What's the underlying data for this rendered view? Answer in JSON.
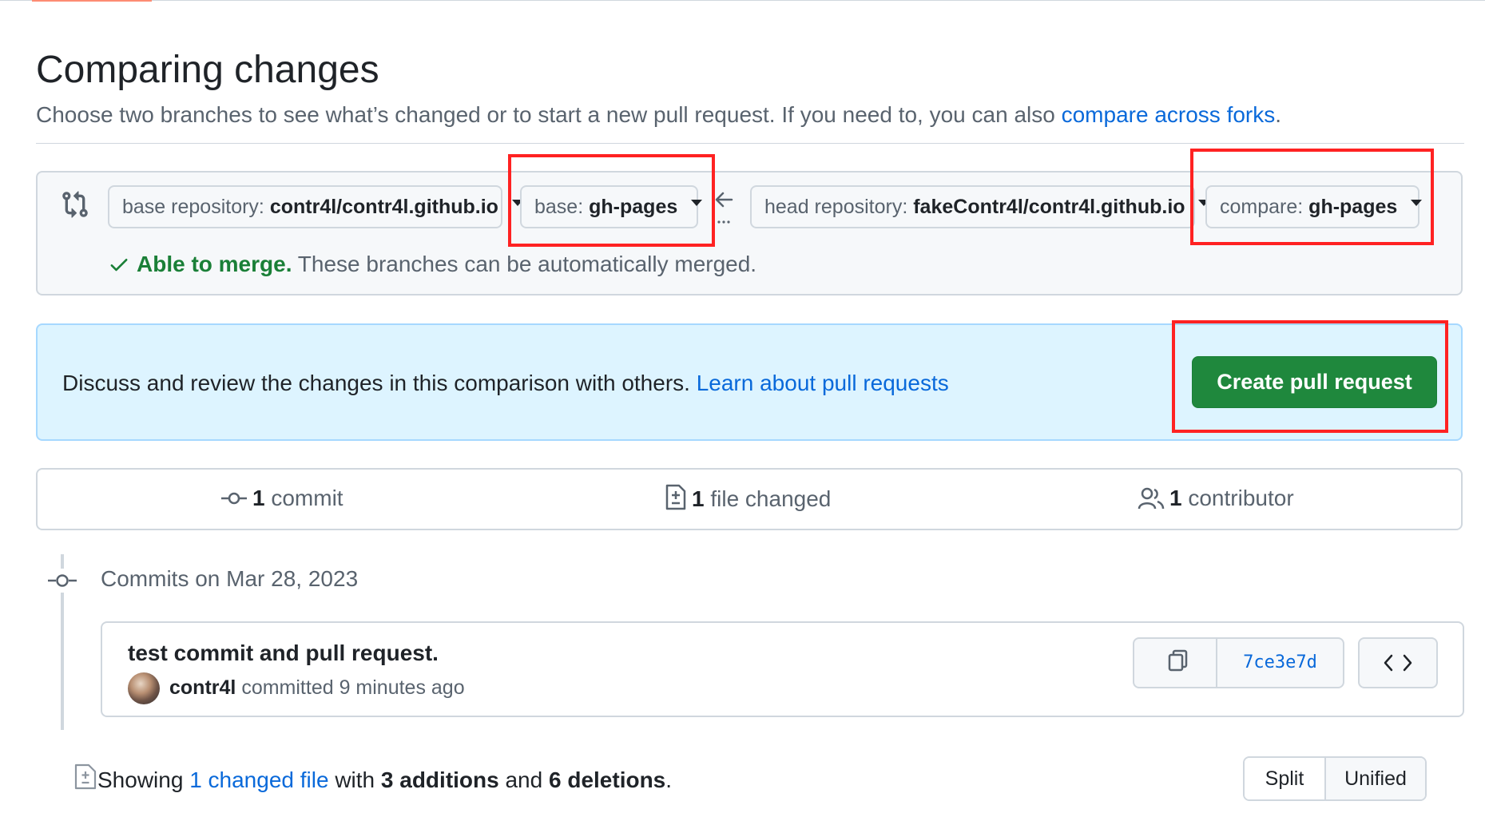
{
  "page": {
    "title": "Comparing changes",
    "subtitle_prefix": "Choose two branches to see what’s changed or to start a new pull request. If you need to, you can also",
    "subtitle_link": "compare across forks",
    "subtitle_suffix": "."
  },
  "range": {
    "base_repo_label": "base repository:",
    "base_repo_value": "contr4l/contr4l.github.io",
    "base_label": "base:",
    "base_value": "gh-pages",
    "head_repo_label": "head repository:",
    "head_repo_value": "fakeContr4l/contr4l.github.io",
    "compare_label": "compare:",
    "compare_value": "gh-pages",
    "merge_status": "Able to merge.",
    "merge_detail": "These branches can be automatically merged."
  },
  "discuss": {
    "text": "Discuss and review the changes in this comparison with others.",
    "link": "Learn about pull requests",
    "button": "Create pull request"
  },
  "summary": {
    "commits_count": "1",
    "commits_label": "commit",
    "files_count": "1",
    "files_label": "file changed",
    "contributors_count": "1",
    "contributors_label": "contributor"
  },
  "commits": {
    "date_heading": "Commits on Mar 28, 2023",
    "items": [
      {
        "message": "test commit and pull request.",
        "author": "contr4l",
        "meta": "committed 9 minutes ago",
        "sha": "7ce3e7d"
      }
    ]
  },
  "files": {
    "prefix": "Showing",
    "changed_link": "1 changed file",
    "with": "with",
    "additions": "3 additions",
    "and": "and",
    "deletions": "6 deletions",
    "suffix": "."
  },
  "view_toggle": {
    "split": "Split",
    "unified": "Unified",
    "selected": "Unified"
  },
  "colors": {
    "primary_button": "#1f883d",
    "link": "#0969da",
    "success": "#1a7f37",
    "annotation_box": "#ff2222"
  }
}
